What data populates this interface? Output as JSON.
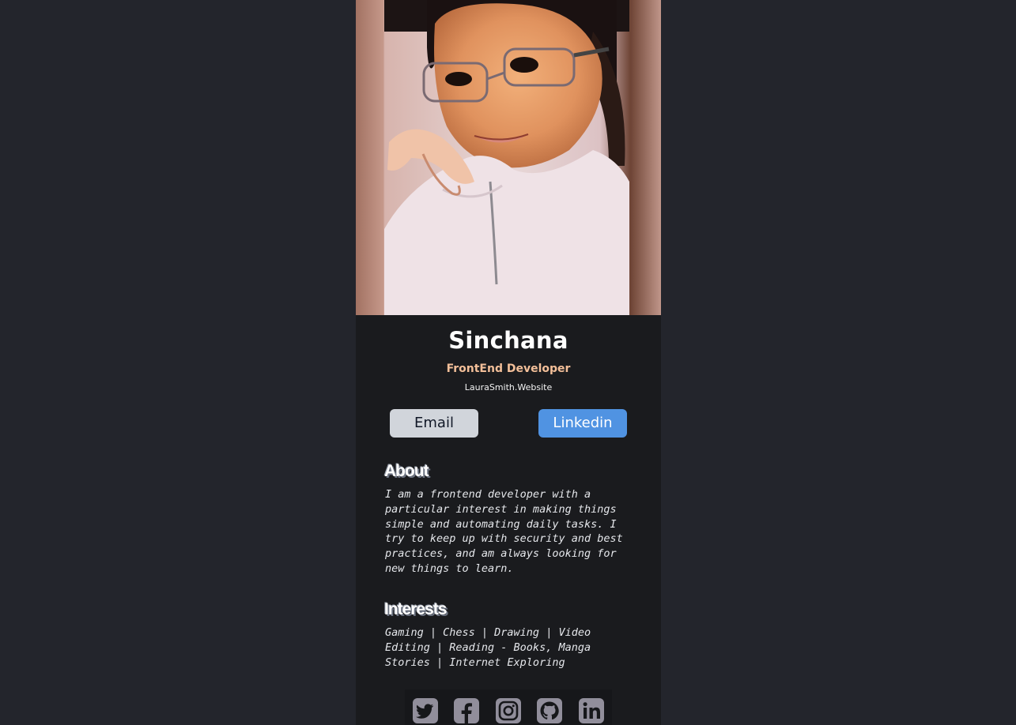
{
  "profile": {
    "name": "Sinchana",
    "role": "FrontEnd Developer",
    "website": "LauraSmith.Website"
  },
  "buttons": {
    "email_label": "Email",
    "linkedin_label": "Linkedin"
  },
  "about": {
    "title": "About",
    "text": "I am a frontend developer with a particular interest in making things simple and automating daily tasks. I try to keep up with security and best practices, and am always looking for new things to learn."
  },
  "interests": {
    "title": "Interests",
    "text": "Gaming | Chess | Drawing | Video Editing | Reading - Books, Manga Stories | Internet Exploring"
  },
  "social": [
    {
      "icon": "twitter-icon"
    },
    {
      "icon": "facebook-icon"
    },
    {
      "icon": "instagram-icon"
    },
    {
      "icon": "github-icon"
    },
    {
      "icon": "linkedin-icon"
    }
  ],
  "colors": {
    "page_background": "#23252c",
    "card_background": "#1a1b1e",
    "role_accent": "#f3bf99",
    "email_button": "#d1d5db",
    "linkedin_button": "#5093e2",
    "icon_color": "#918e9b"
  }
}
